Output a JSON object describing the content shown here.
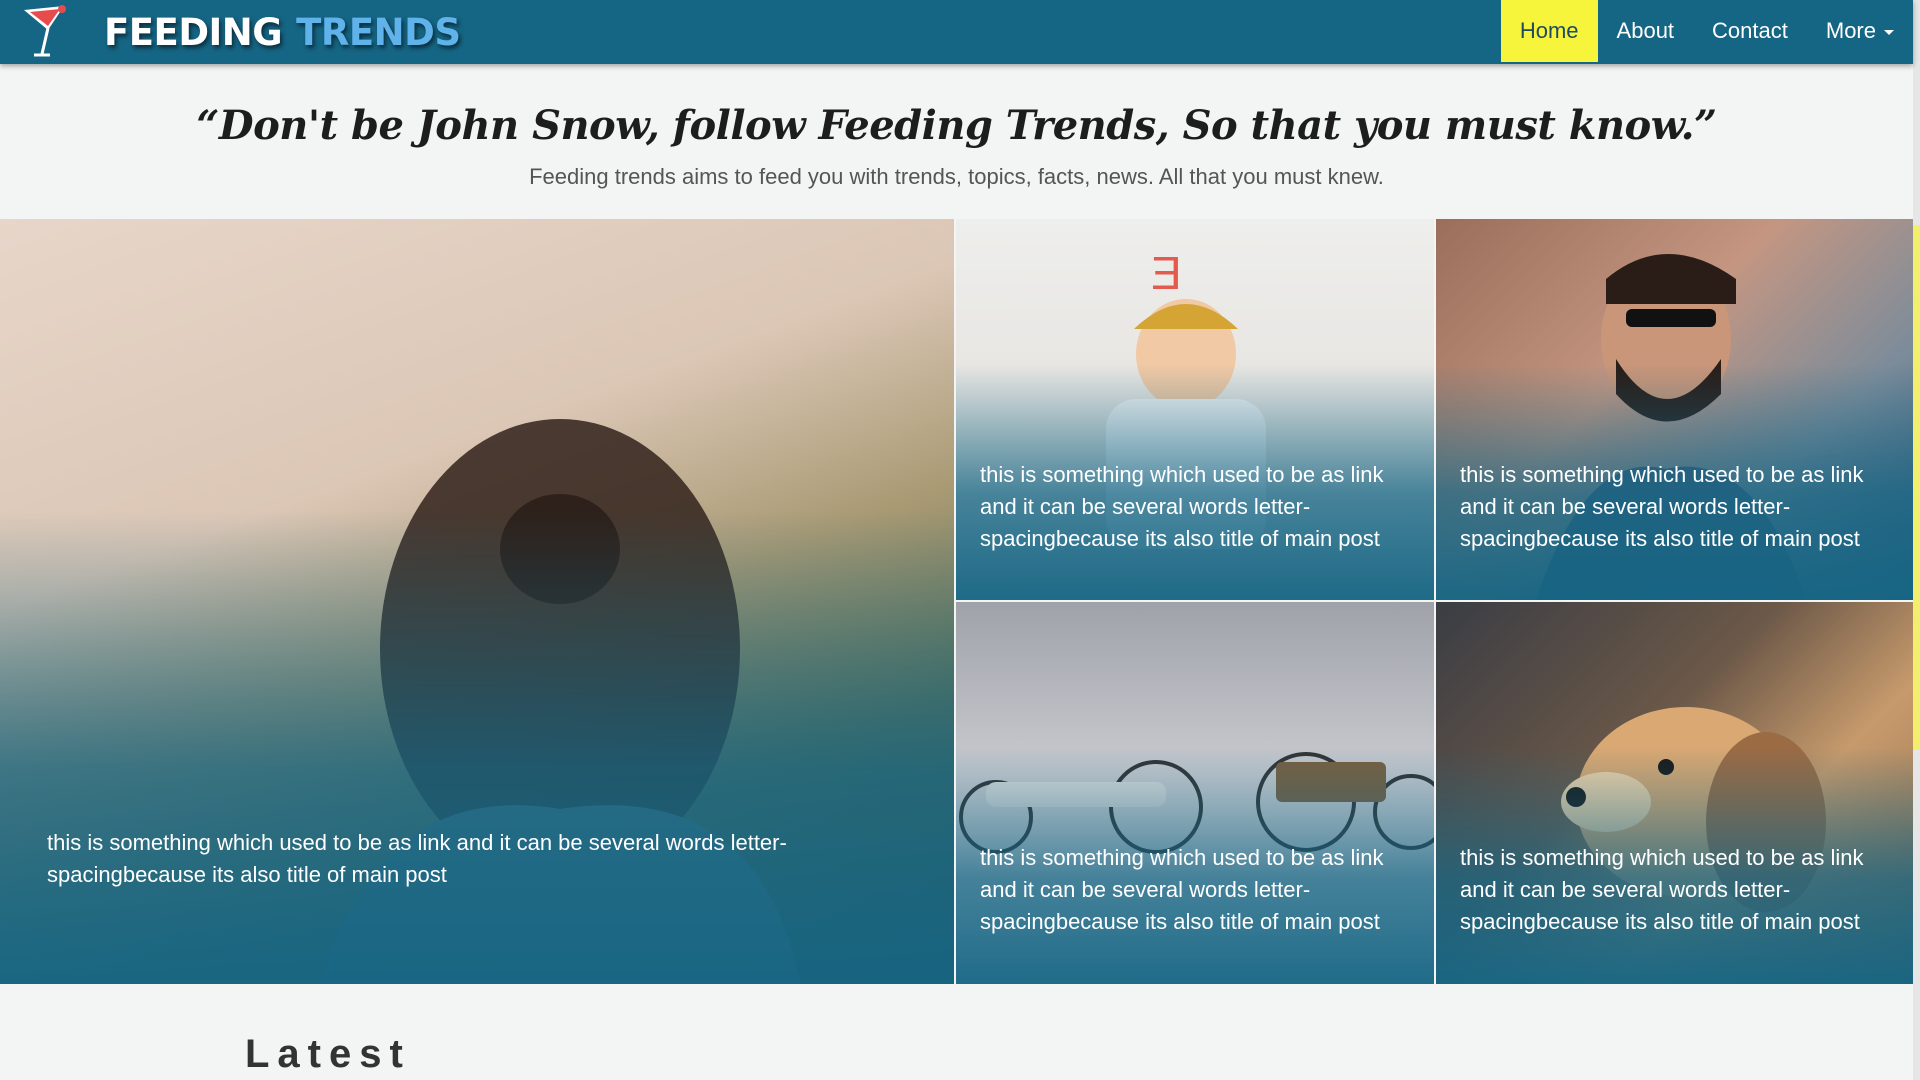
{
  "brand": {
    "word1": "FEEDING",
    "word2": "TRENDS",
    "icon": "cocktail-glass-icon"
  },
  "nav": {
    "items": [
      {
        "label": "Home",
        "active": true
      },
      {
        "label": "About",
        "active": false
      },
      {
        "label": "Contact",
        "active": false
      },
      {
        "label": "More",
        "active": false,
        "dropdown": true
      }
    ]
  },
  "hero": {
    "quote": "“Don't be John Snow, follow Feeding Trends, So that you must know.”",
    "tagline": "Feeding trends aims to feed you with trends, topics, facts, news. All that you must knew."
  },
  "posts": [
    {
      "title": "this is something which used to be as link and it can be several words letter-spacingbecause its also title of main post"
    },
    {
      "title": "this is something which used to be as link and it can be several words letter-spacingbecause its also title of main post"
    },
    {
      "title": "this is something which used to be as link and it can be several words letter-spacingbecause its also title of main post"
    },
    {
      "title": "this is something which used to be as link and it can be several words letter-spacingbecause its also title of main post"
    },
    {
      "title": "this is something which used to be as link and it can be several words letter-spacingbecause its also title of main post"
    }
  ],
  "sections": {
    "latest": "Latest"
  },
  "colors": {
    "navbar": "#156584",
    "active_nav": "#f7f43c",
    "brand_accent": "#5fb3ea",
    "overlay": "#156584"
  }
}
